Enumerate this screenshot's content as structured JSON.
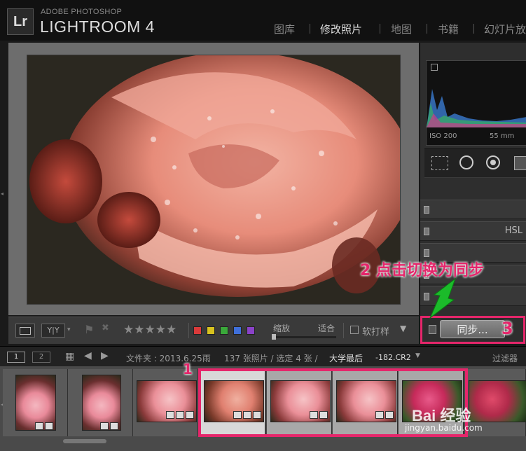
{
  "app": {
    "brand_top": "ADOBE PHOTOSHOP",
    "brand_main": "LIGHTROOM 4",
    "logo": "Lr"
  },
  "modules": [
    "图库",
    "修改照片",
    "地图",
    "书籍",
    "幻灯片放"
  ],
  "active_module": "修改照片",
  "histogram": {
    "iso": "ISO 200",
    "focal": "55 mm"
  },
  "panels": {
    "hsl": "HSL"
  },
  "toolbar": {
    "yy": "Y|Y",
    "stars": "★★★★★",
    "zoom_label": "缩放",
    "fit_label": "适合",
    "soft_proof": "软打样"
  },
  "label_colors": [
    "#d93a3a",
    "#d8c21f",
    "#3aa83a",
    "#3f6fd9",
    "#8a42c8"
  ],
  "sync": {
    "label": "同步..."
  },
  "annotations": {
    "step1": "1",
    "step2": "2 点击切换为同步",
    "step3": "3",
    "accent": "#e5266b"
  },
  "filmbar": {
    "page1": "1",
    "page2": "2",
    "folder_text": "文件夹 : 2013.6.25雨",
    "count_text": "137 张照片 / 选定 4 张 /",
    "filename_prefix": "大学最后",
    "filename_suffix": "-182.CR2",
    "filter_label": "过滤器"
  },
  "watermark": {
    "logo": "Bai 经验",
    "url": "jingyan.baidu.com"
  }
}
